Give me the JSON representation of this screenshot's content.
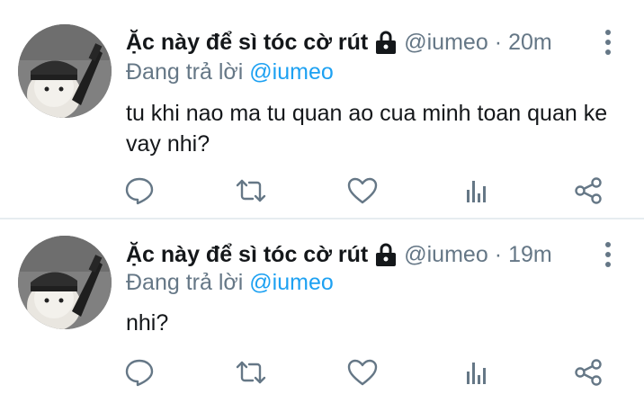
{
  "tweets": [
    {
      "author_name": "Ặc này để sì tóc cờ rút",
      "handle": "@iumeo",
      "separator": "·",
      "time": "20m",
      "reply_prefix": "Đang trả lời",
      "reply_to": "@iumeo",
      "text": "tu khi nao ma tu quan ao cua minh toan quan ke vay nhi?",
      "protected_icon": "lock-icon"
    },
    {
      "author_name": "Ặc này để sì tóc cờ rút",
      "handle": "@iumeo",
      "separator": "·",
      "time": "19m",
      "reply_prefix": "Đang trả lời",
      "reply_to": "@iumeo",
      "text": "nhi?",
      "protected_icon": "lock-icon"
    }
  ],
  "action_icons": [
    "reply-icon",
    "retweet-icon",
    "like-icon",
    "analytics-icon",
    "share-icon"
  ],
  "colors": {
    "name": "#14171a",
    "secondary": "#657786",
    "mention": "#1da1f2",
    "icon": "#657786",
    "divider": "#e6ecf0"
  }
}
